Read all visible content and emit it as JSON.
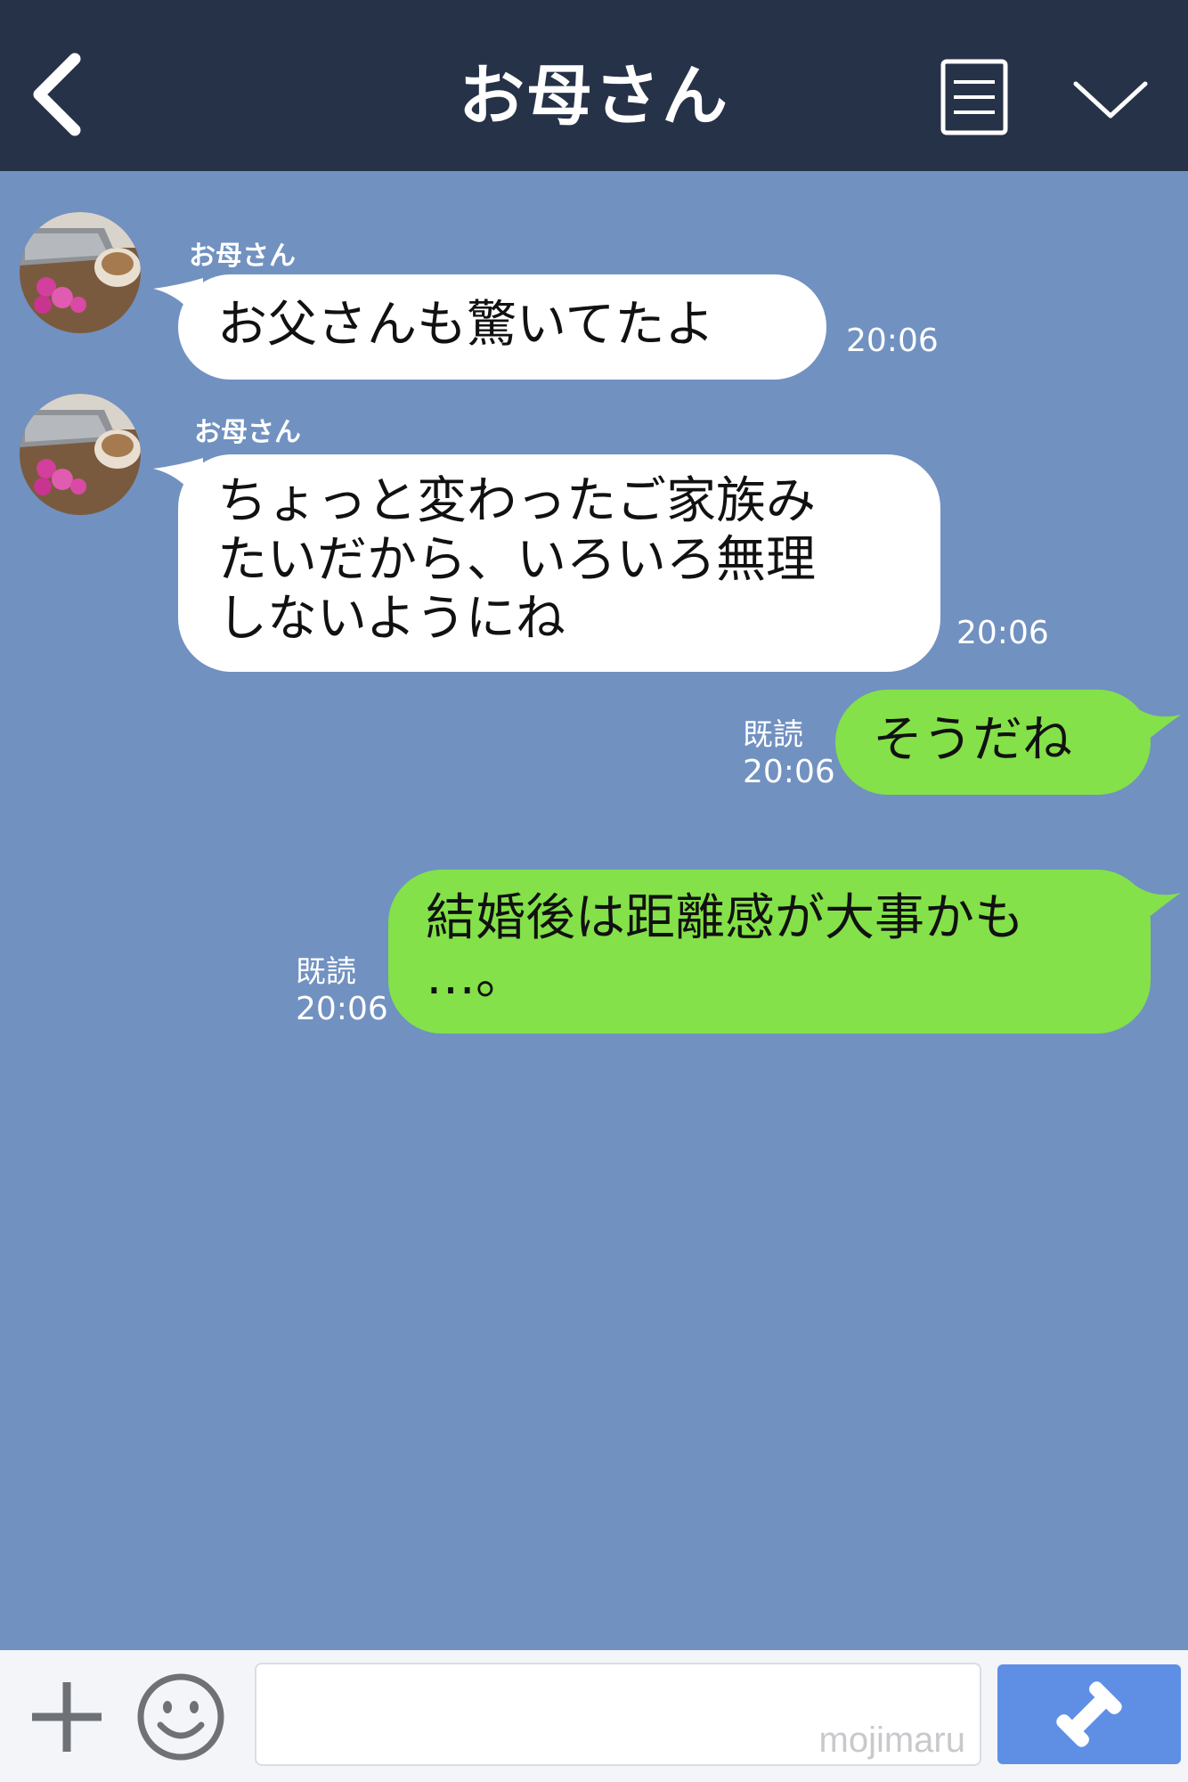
{
  "header": {
    "title": "お母さん",
    "back_icon": "chevron-left-icon",
    "menu_icon": "menu-list-icon",
    "collapse_icon": "chevron-down-icon"
  },
  "messages": [
    {
      "side": "in",
      "sender": "お母さん",
      "lines": [
        "お父さんも驚いてたよ"
      ],
      "time": "20:06"
    },
    {
      "side": "in",
      "sender": "お母さん",
      "lines": [
        "ちょっと変わったご家族み",
        "たいだから、いろいろ無理",
        "しないようにね"
      ],
      "time": "20:06"
    },
    {
      "side": "out",
      "lines": [
        "そうだね"
      ],
      "read": "既読",
      "time": "20:06"
    },
    {
      "side": "out",
      "lines": [
        "結婚後は距離感が大事かも",
        "…。"
      ],
      "read": "既読",
      "time": "20:06"
    }
  ],
  "footer": {
    "input_value": "",
    "watermark": "mojimaru",
    "plus_icon": "plus-icon",
    "emoji_icon": "smiley-icon",
    "call_icon": "phone-icon"
  },
  "colors": {
    "background": "#7191c1",
    "header": "#263248",
    "incoming_bubble": "#ffffff",
    "outgoing_bubble": "#84e149",
    "call_button": "#5e8fe5"
  }
}
